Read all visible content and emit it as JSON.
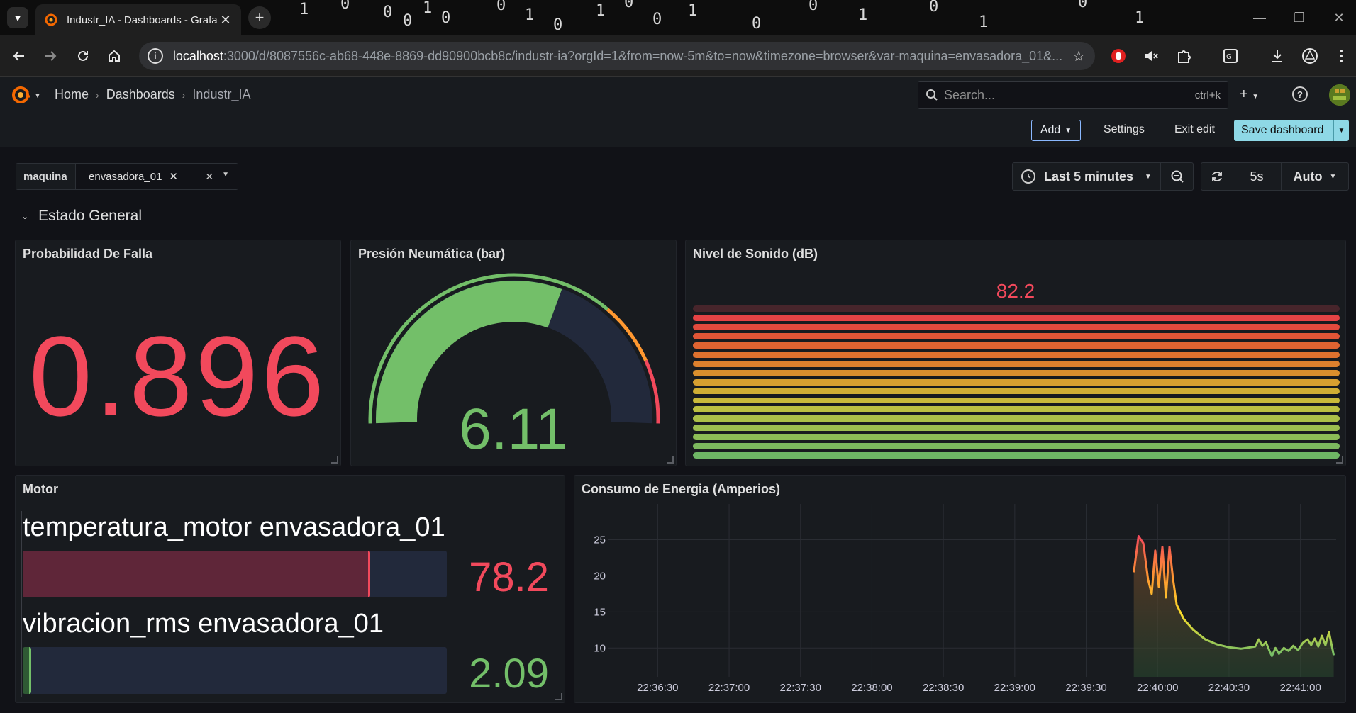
{
  "browser": {
    "tab_title": "Industr_IA - Dashboards - Grafana",
    "url_host": "localhost",
    "url_rest": ":3000/d/8087556c-ab68-448e-8869-dd90900bcb8c/industr-ia?orgId=1&from=now-5m&to=now&timezone=browser&var-maquina=envasadora_01&..."
  },
  "nav": {
    "breadcrumbs": [
      "Home",
      "Dashboards",
      "Industr_IA"
    ],
    "search_placeholder": "Search...",
    "search_shortcut": "ctrl+k"
  },
  "editbar": {
    "add_label": "Add",
    "settings_label": "Settings",
    "exit_label": "Exit edit",
    "save_label": "Save dashboard"
  },
  "variables": {
    "label": "maquina",
    "value": "envasadora_01"
  },
  "time": {
    "range": "Last 5 minutes",
    "refresh_interval": "5s",
    "refresh_mode": "Auto"
  },
  "row": {
    "title": "Estado General"
  },
  "panels": {
    "falla": {
      "title": "Probabilidad De Falla",
      "value": "0.896"
    },
    "presion": {
      "title": "Presión Neumática (bar)",
      "value": "6.11",
      "fraction": 0.61
    },
    "sonido": {
      "title": "Nivel de Sonido (dB)",
      "value": "82.2",
      "fraction": 0.95,
      "segments": 17
    },
    "motor": {
      "title": "Motor",
      "rows": [
        {
          "label": "temperatura_motor envasadora_01",
          "value": "78.2",
          "fraction": 0.82,
          "color": "#f2495c"
        },
        {
          "label": "vibracion_rms envasadora_01",
          "value": "2.09",
          "fraction": 0.02,
          "color": "#73bf69"
        }
      ]
    },
    "energia": {
      "title": "Consumo de Energia (Amperios)"
    }
  },
  "colors": {
    "red": "#f2495c",
    "green": "#73bf69",
    "orange": "#ff9830",
    "background": "#111217",
    "panel": "#181b1f"
  },
  "chart_data": {
    "type": "line",
    "title": "Consumo de Energia (Amperios)",
    "x_ticks": [
      "22:36:30",
      "22:37:00",
      "22:37:30",
      "22:38:00",
      "22:38:30",
      "22:39:00",
      "22:39:30",
      "22:40:00",
      "22:40:30",
      "22:41:00"
    ],
    "y_ticks": [
      10,
      15,
      20,
      25
    ],
    "ylim": [
      6,
      28
    ],
    "x_range_seconds": [
      0,
      300
    ],
    "series": [
      {
        "values": [
          [
            215,
            20.5
          ],
          [
            217,
            25.5
          ],
          [
            219,
            24.5
          ],
          [
            221,
            19.5
          ],
          [
            222.5,
            17.5
          ],
          [
            224,
            23.5
          ],
          [
            225.5,
            18.5
          ],
          [
            227,
            24.0
          ],
          [
            228.5,
            17.0
          ],
          [
            230,
            24.0
          ],
          [
            231.5,
            19.5
          ],
          [
            233,
            16.0
          ],
          [
            236,
            14.0
          ],
          [
            240,
            12.5
          ],
          [
            245,
            11.2
          ],
          [
            250,
            10.5
          ],
          [
            255,
            10.1
          ],
          [
            260,
            9.9
          ],
          [
            266,
            10.2
          ],
          [
            267.5,
            11.2
          ],
          [
            269,
            10.3
          ],
          [
            270.5,
            10.8
          ],
          [
            272,
            9.6
          ],
          [
            273,
            8.9
          ],
          [
            274.5,
            10.0
          ],
          [
            276,
            9.2
          ],
          [
            278,
            10.0
          ],
          [
            280,
            9.6
          ],
          [
            282,
            10.3
          ],
          [
            284,
            9.7
          ],
          [
            286,
            10.7
          ],
          [
            288,
            11.2
          ],
          [
            289.5,
            10.4
          ],
          [
            291,
            11.3
          ],
          [
            292.5,
            10.2
          ],
          [
            294,
            11.7
          ],
          [
            295.5,
            10.4
          ],
          [
            297,
            12.2
          ],
          [
            299,
            9.0
          ]
        ]
      }
    ]
  }
}
